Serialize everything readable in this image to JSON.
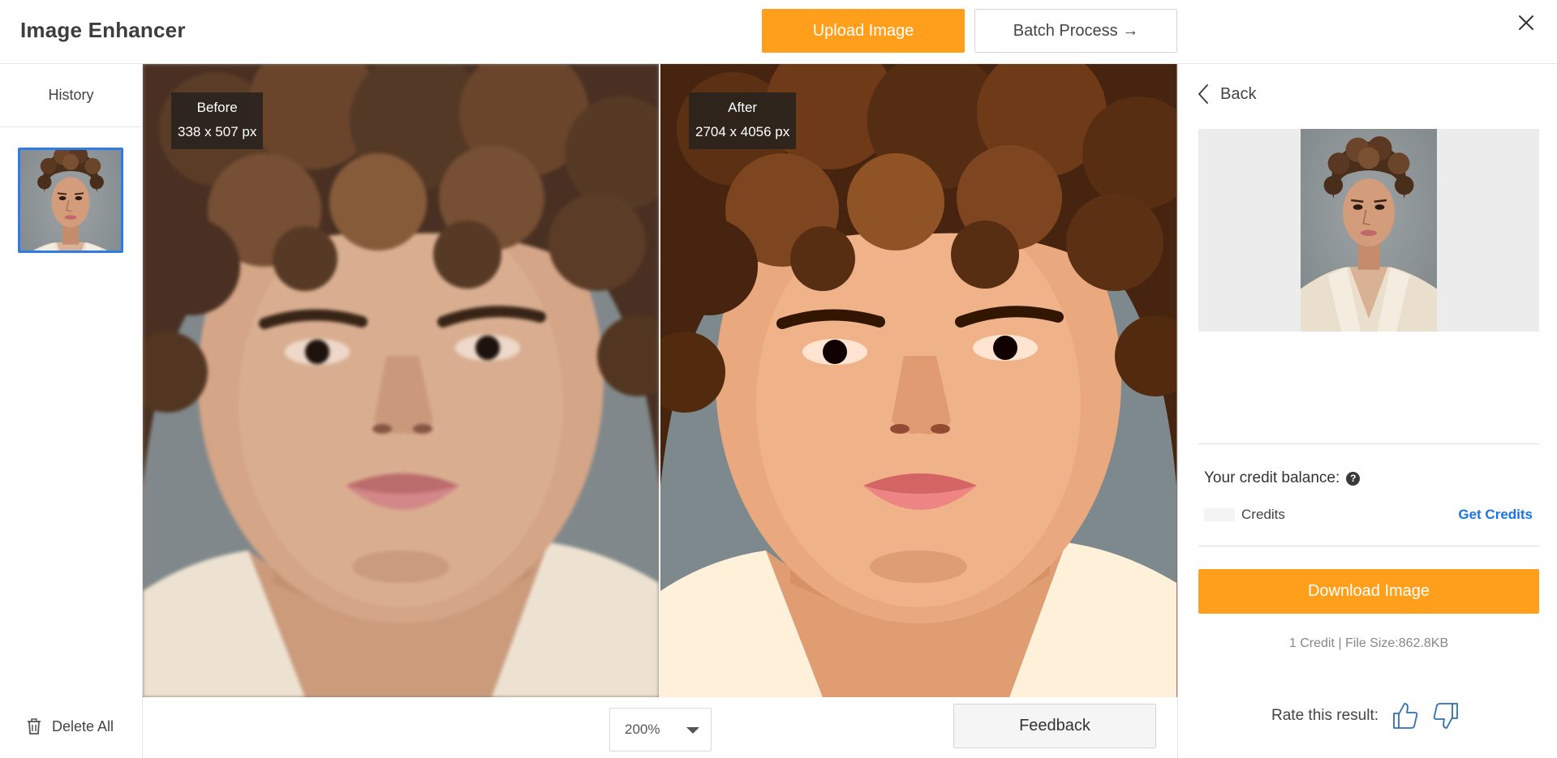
{
  "header": {
    "app_title": "Image Enhancer",
    "upload_label": "Upload Image",
    "batch_label": "Batch Process →"
  },
  "sidebar": {
    "history_label": "History",
    "delete_all_label": "Delete All"
  },
  "viewer": {
    "before_label": "Before",
    "before_size": "338 x 507 px",
    "after_label": "After",
    "after_size": "2704 x 4056 px"
  },
  "bottombar": {
    "zoom_value": "200%",
    "feedback_label": "Feedback"
  },
  "panel": {
    "back_label": "Back",
    "credit_balance_label": "Your credit balance:",
    "credits_label": "Credits",
    "get_credits_label": "Get Credits",
    "download_label": "Download Image",
    "file_info": "1 Credit | File Size:862.8KB",
    "rate_label": "Rate this result:"
  },
  "colors": {
    "accent": "#ff9f1c",
    "link": "#1a73e8",
    "selection": "#2f7de1"
  },
  "icons": [
    "close-icon",
    "trash-icon",
    "chevron-left-icon",
    "help-icon",
    "thumbs-up-icon",
    "thumbs-down-icon",
    "chevron-down-icon"
  ]
}
